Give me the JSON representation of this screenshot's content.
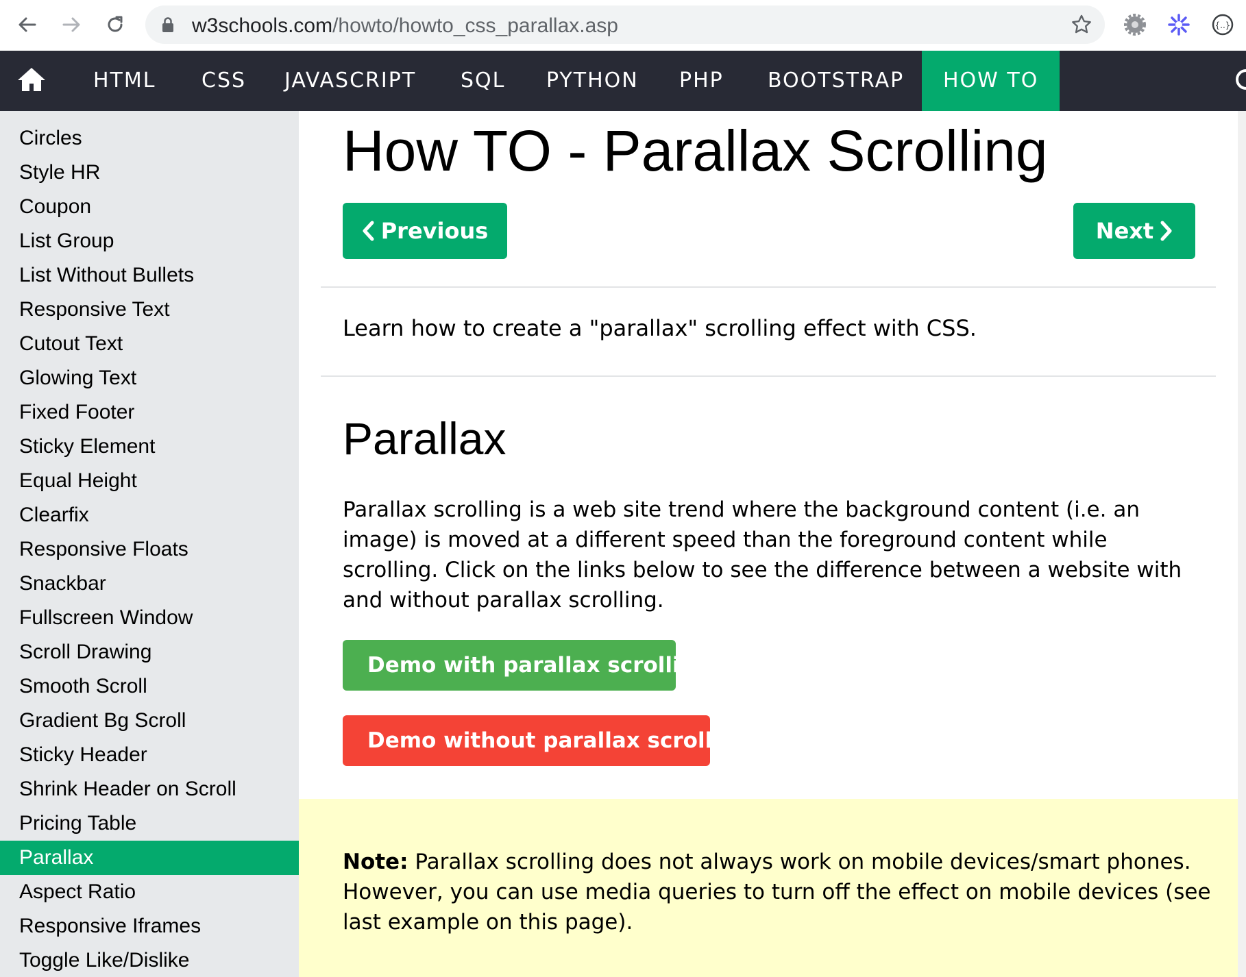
{
  "browser": {
    "url_domain": "w3schools.com",
    "url_path": "/howto/howto_css_parallax.asp"
  },
  "topnav": {
    "items": [
      "HTML",
      "CSS",
      "JAVASCRIPT",
      "SQL",
      "PYTHON",
      "PHP",
      "BOOTSTRAP",
      "HOW TO"
    ],
    "active": "HOW TO"
  },
  "sidebar": {
    "items": [
      "Circles",
      "Style HR",
      "Coupon",
      "List Group",
      "List Without Bullets",
      "Responsive Text",
      "Cutout Text",
      "Glowing Text",
      "Fixed Footer",
      "Sticky Element",
      "Equal Height",
      "Clearfix",
      "Responsive Floats",
      "Snackbar",
      "Fullscreen Window",
      "Scroll Drawing",
      "Smooth Scroll",
      "Gradient Bg Scroll",
      "Sticky Header",
      "Shrink Header on Scroll",
      "Pricing Table",
      "Parallax",
      "Aspect Ratio",
      "Responsive Iframes",
      "Toggle Like/Dislike"
    ],
    "active": "Parallax"
  },
  "main": {
    "title": "How TO - Parallax Scrolling",
    "prev_label": "Previous",
    "next_label": "Next",
    "intro": "Learn how to create a \"parallax\" scrolling effect with CSS.",
    "section_title": "Parallax",
    "paragraph": "Parallax scrolling is a web site trend where the background content (i.e. an image) is moved at a different speed than the foreground content while scrolling. Click on the links below to see the difference between a website with and without parallax scrolling.",
    "demo_with": "Demo with parallax scrolling",
    "demo_without": "Demo without parallax scrolling",
    "note_label": "Note:",
    "note_text": " Parallax scrolling does not always work on mobile devices/smart phones. However, you can use media queries to turn off the effect on mobile devices (see last example on this page)."
  },
  "colors": {
    "accent": "#04aa6d",
    "nav_bg": "#282a35",
    "sidebar_bg": "#e7e9eb",
    "demo_green": "#4caf50",
    "demo_red": "#f44336",
    "note_bg": "#ffffcc"
  },
  "icons": [
    "back-arrow-icon",
    "forward-arrow-icon",
    "reload-icon",
    "lock-icon",
    "star-icon",
    "gear-icon",
    "extension-icon",
    "json-icon",
    "home-icon",
    "search-icon",
    "chevron-left-icon",
    "chevron-right-icon"
  ]
}
